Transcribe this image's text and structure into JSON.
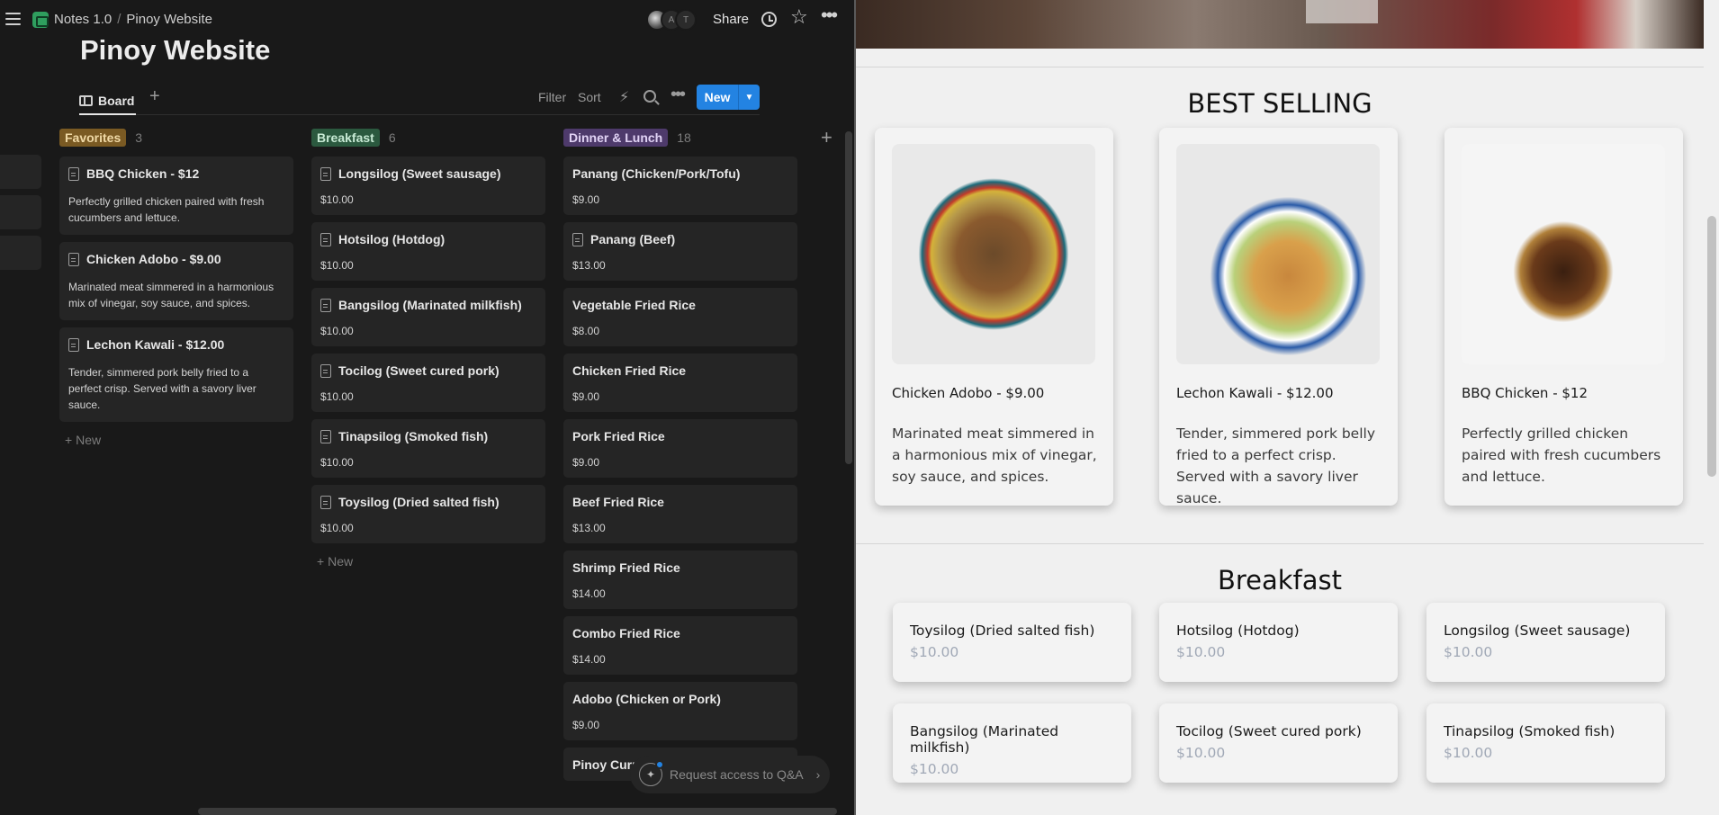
{
  "app": {
    "breadcrumb": [
      "Notes 1.0",
      "Pinoy Website"
    ],
    "separator": "/",
    "avatars": [
      "",
      "A",
      "T"
    ],
    "share_label": "Share",
    "page_title": "Pinoy Website"
  },
  "viewbar": {
    "tab_label": "Board",
    "filter_label": "Filter",
    "sort_label": "Sort",
    "new_label": "New",
    "bolt_glyph": "⚡"
  },
  "columns": [
    {
      "name": "Favorites",
      "count": "3",
      "tag_bg": "#7a5a23",
      "tag_fg": "#f0d9a6",
      "cards": [
        {
          "title": "BBQ Chicken - $12",
          "text": "Perfectly grilled chicken paired with fresh cucumbers and lettuce.",
          "icon": true
        },
        {
          "title": "Chicken Adobo - $9.00",
          "text": "Marinated meat simmered in a harmonious mix of vinegar, soy sauce, and spices.",
          "icon": true
        },
        {
          "title": "Lechon Kawali - $12.00",
          "text": "Tender, simmered pork belly fried to a perfect crisp. Served with a savory liver sauce.",
          "icon": true
        }
      ],
      "new_label": "New"
    },
    {
      "name": "Breakfast",
      "count": "6",
      "tag_bg": "#2b593f",
      "tag_fg": "#c8ead5",
      "cards": [
        {
          "title": "Longsilog (Sweet sausage)",
          "price": "$10.00",
          "icon": true
        },
        {
          "title": "Hotsilog (Hotdog)",
          "price": "$10.00",
          "icon": true
        },
        {
          "title": "Bangsilog (Marinated milkfish)",
          "price": "$10.00",
          "icon": true
        },
        {
          "title": "Tocilog (Sweet cured pork)",
          "price": "$10.00",
          "icon": true
        },
        {
          "title": "Tinapsilog (Smoked fish)",
          "price": "$10.00",
          "icon": true
        },
        {
          "title": "Toysilog (Dried salted fish)",
          "price": "$10.00",
          "icon": true
        }
      ],
      "new_label": "New"
    },
    {
      "name": "Dinner & Lunch",
      "count": "18",
      "tag_bg": "#4e3a6b",
      "tag_fg": "#e1d3f5",
      "cards": [
        {
          "title": "Panang (Chicken/Pork/Tofu)",
          "price": "$9.00",
          "icon": false
        },
        {
          "title": "Panang (Beef)",
          "price": "$13.00",
          "icon": true
        },
        {
          "title": "Vegetable Fried Rice",
          "price": "$8.00",
          "icon": false
        },
        {
          "title": "Chicken Fried Rice",
          "price": "$9.00",
          "icon": false
        },
        {
          "title": "Pork Fried Rice",
          "price": "$9.00",
          "icon": false
        },
        {
          "title": "Beef Fried Rice",
          "price": "$13.00",
          "icon": false
        },
        {
          "title": "Shrimp Fried Rice",
          "price": "$14.00",
          "icon": false
        },
        {
          "title": "Combo Fried Rice",
          "price": "$14.00",
          "icon": false
        },
        {
          "title": "Adobo (Chicken or Pork)",
          "price": "$9.00",
          "icon": false
        },
        {
          "title": "Pinoy Curry in Coconut Milk",
          "price": "",
          "icon": false
        }
      ]
    }
  ],
  "qa_label": "Request access to Q&A",
  "website": {
    "best_selling_title": "BEST SELLING",
    "best_selling": [
      {
        "name": "Chicken Adobo - $9.00",
        "desc": "Marinated meat simmered in a harmonious mix of vinegar, soy sauce, and spices.",
        "img": "img-adobo"
      },
      {
        "name": "Lechon Kawali - $12.00",
        "desc": "Tender, simmered pork belly fried to a perfect crisp. Served with a savory liver sauce.",
        "img": "img-lechon"
      },
      {
        "name": "BBQ Chicken - $12",
        "desc": "Perfectly grilled chicken paired with fresh cucumbers and lettuce.",
        "img": "img-bbq"
      }
    ],
    "breakfast_title": "Breakfast",
    "breakfast": [
      {
        "name": "Toysilog (Dried salted fish)",
        "price": "$10.00"
      },
      {
        "name": "Hotsilog (Hotdog)",
        "price": "$10.00"
      },
      {
        "name": "Longsilog (Sweet sausage)",
        "price": "$10.00"
      },
      {
        "name": "Bangsilog (Marinated milkfish)",
        "price": "$10.00"
      },
      {
        "name": "Tocilog (Sweet cured pork)",
        "price": "$10.00"
      },
      {
        "name": "Tinapsilog (Smoked fish)",
        "price": "$10.00"
      }
    ]
  }
}
